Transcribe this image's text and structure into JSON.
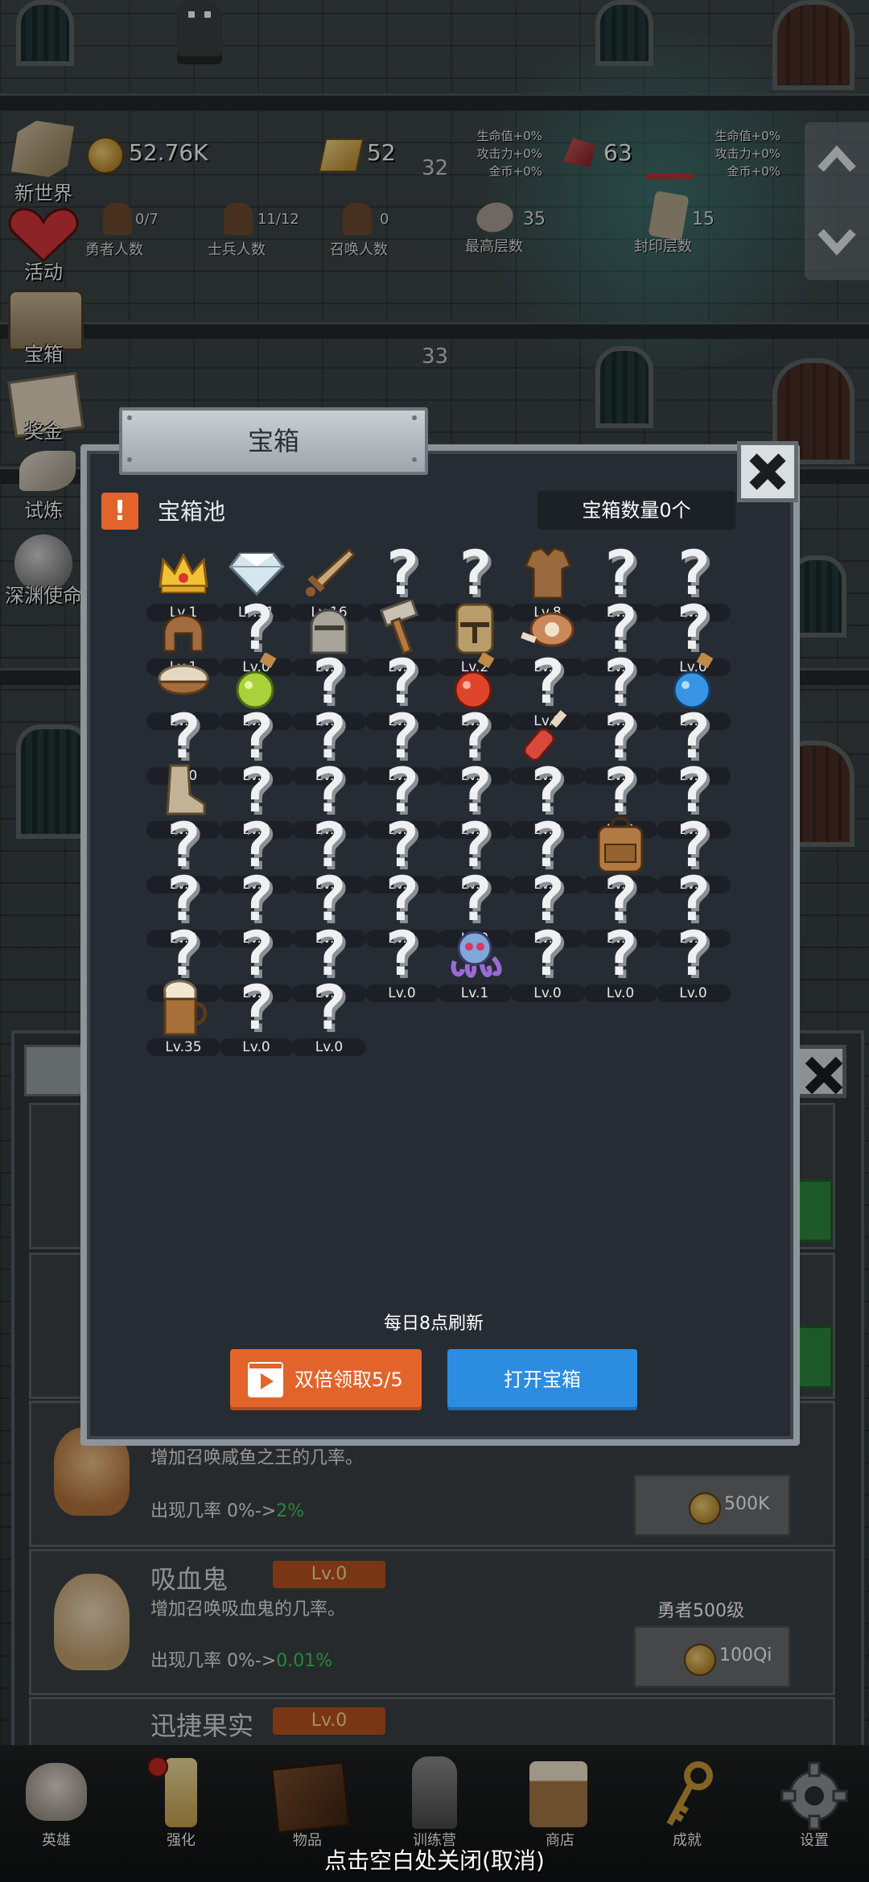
{
  "resources": {
    "gold": "52.76K",
    "bars": "52",
    "gems": "63",
    "bonus_lines_1": [
      "生命值+0%",
      "攻击力+0%",
      "金币+0%"
    ],
    "bonus_lines_2": [
      "生命值+0%",
      "攻击力+0%",
      "金币+0%"
    ]
  },
  "counts": [
    {
      "value": "0/7",
      "label": "勇者人数"
    },
    {
      "value": "11/12",
      "label": "士兵人数"
    },
    {
      "value": "0",
      "label": "召唤人数"
    },
    {
      "value": "35",
      "label": "最高层数"
    },
    {
      "value": "15",
      "label": "封印层数"
    }
  ],
  "floors": [
    "32",
    "33"
  ],
  "side_menu": [
    "新世界",
    "活动",
    "宝箱",
    "奖金",
    "试炼",
    "深渊使命"
  ],
  "modal": {
    "title": "宝箱",
    "pool_icon": "!",
    "pool_title": "宝箱池",
    "chest_count": "宝箱数量0个",
    "refresh_text": "每日8点刷新",
    "double_button": "双倍领取5/5",
    "open_button": "打开宝箱",
    "items": [
      {
        "icon": "crown",
        "level": "Lv.1"
      },
      {
        "icon": "diamond",
        "level": "Lv.11"
      },
      {
        "icon": "sword",
        "level": "Lv.16"
      },
      {
        "icon": "unknown",
        "level": "Lv.0"
      },
      {
        "icon": "unknown",
        "level": "Lv.0"
      },
      {
        "icon": "leather-armor",
        "level": "Lv.8"
      },
      {
        "icon": "unknown",
        "level": "Lv.0"
      },
      {
        "icon": "unknown",
        "level": "Lv.0"
      },
      {
        "icon": "leather-helmet",
        "level": "Lv.1"
      },
      {
        "icon": "unknown",
        "level": "Lv.0"
      },
      {
        "icon": "knight-helmet",
        "level": "Lv.1"
      },
      {
        "icon": "hammer",
        "level": "Lv.1"
      },
      {
        "icon": "great-helm",
        "level": "Lv.2"
      },
      {
        "icon": "ham",
        "level": "Lv.1"
      },
      {
        "icon": "unknown",
        "level": "Lv.0"
      },
      {
        "icon": "unknown",
        "level": "Lv.0"
      },
      {
        "icon": "bread-bowl",
        "level": "Lv.2"
      },
      {
        "icon": "green-potion",
        "level": "Lv.1"
      },
      {
        "icon": "unknown",
        "level": "Lv.0"
      },
      {
        "icon": "unknown",
        "level": "Lv.0"
      },
      {
        "icon": "red-potion",
        "level": "Lv.1"
      },
      {
        "icon": "unknown",
        "level": "Lv.0"
      },
      {
        "icon": "unknown",
        "level": "Lv.0"
      },
      {
        "icon": "blue-potion",
        "level": "Lv.1"
      },
      {
        "icon": "unknown",
        "level": "Lv.0"
      },
      {
        "icon": "unknown",
        "level": "Lv.0"
      },
      {
        "icon": "unknown",
        "level": "Lv.0"
      },
      {
        "icon": "unknown",
        "level": "Lv.0"
      },
      {
        "icon": "unknown",
        "level": "Lv.0"
      },
      {
        "icon": "red-bottle",
        "level": "Lv.1"
      },
      {
        "icon": "unknown",
        "level": "Lv.0"
      },
      {
        "icon": "unknown",
        "level": "Lv.0"
      },
      {
        "icon": "boot",
        "level": "Lv.1"
      },
      {
        "icon": "unknown",
        "level": "Lv.0"
      },
      {
        "icon": "unknown",
        "level": "Lv.0"
      },
      {
        "icon": "unknown",
        "level": "Lv.0"
      },
      {
        "icon": "unknown",
        "level": "Lv.0"
      },
      {
        "icon": "unknown",
        "level": "Lv.0"
      },
      {
        "icon": "unknown",
        "level": "Lv.0"
      },
      {
        "icon": "unknown",
        "level": "Lv.0"
      },
      {
        "icon": "unknown",
        "level": "Lv.0"
      },
      {
        "icon": "unknown",
        "level": "Lv.0"
      },
      {
        "icon": "unknown",
        "level": "Lv.0"
      },
      {
        "icon": "unknown",
        "level": "Lv.0"
      },
      {
        "icon": "unknown",
        "level": "Lv.0"
      },
      {
        "icon": "unknown",
        "level": "Lv.0"
      },
      {
        "icon": "backpack",
        "level": "Lv.2"
      },
      {
        "icon": "unknown",
        "level": "Lv.0"
      },
      {
        "icon": "unknown",
        "level": "Lv.0"
      },
      {
        "icon": "unknown",
        "level": "Lv.0"
      },
      {
        "icon": "unknown",
        "level": "Lv.0"
      },
      {
        "icon": "unknown",
        "level": "Lv.0"
      },
      {
        "icon": "unknown",
        "level": "Lv.0"
      },
      {
        "icon": "unknown",
        "level": "Lv.0"
      },
      {
        "icon": "unknown",
        "level": "Lv.0"
      },
      {
        "icon": "unknown",
        "level": "Lv.0"
      },
      {
        "icon": "unknown",
        "level": "Lv.0"
      },
      {
        "icon": "unknown",
        "level": "Lv.0"
      },
      {
        "icon": "unknown",
        "level": "Lv.0"
      },
      {
        "icon": "unknown",
        "level": "Lv.0"
      },
      {
        "icon": "tentacle-monster",
        "level": "Lv.1"
      },
      {
        "icon": "unknown",
        "level": "Lv.0"
      },
      {
        "icon": "unknown",
        "level": "Lv.0"
      },
      {
        "icon": "unknown",
        "level": "Lv.0"
      },
      {
        "icon": "beer-mug",
        "level": "Lv.35"
      },
      {
        "icon": "unknown",
        "level": "Lv.0"
      },
      {
        "icon": "unknown",
        "level": "Lv.0"
      }
    ]
  },
  "underlying_list": {
    "item1": {
      "desc": "增加召唤咸鱼之王的几率。",
      "rate_prefix": "出现几率 0%->",
      "rate_new": "2%",
      "price": "500K"
    },
    "item2": {
      "name": "吸血鬼",
      "level": "Lv.0",
      "desc": "增加召唤吸血鬼的几率。",
      "rate_prefix": "出现几率 0%->",
      "rate_new": "0.01%",
      "requirement": "勇者500级",
      "price": "100Qi"
    },
    "item3": {
      "name": "迅捷果实",
      "level": "Lv.0"
    }
  },
  "nav": [
    "英雄",
    "强化",
    "物品",
    "训练营",
    "商店",
    "成就",
    "设置"
  ],
  "close_hint": "点击空白处关闭(取消)",
  "colors": {
    "accent_orange": "#e2642b",
    "accent_blue": "#2c8ce0",
    "rate_green": "#3bd15a"
  }
}
